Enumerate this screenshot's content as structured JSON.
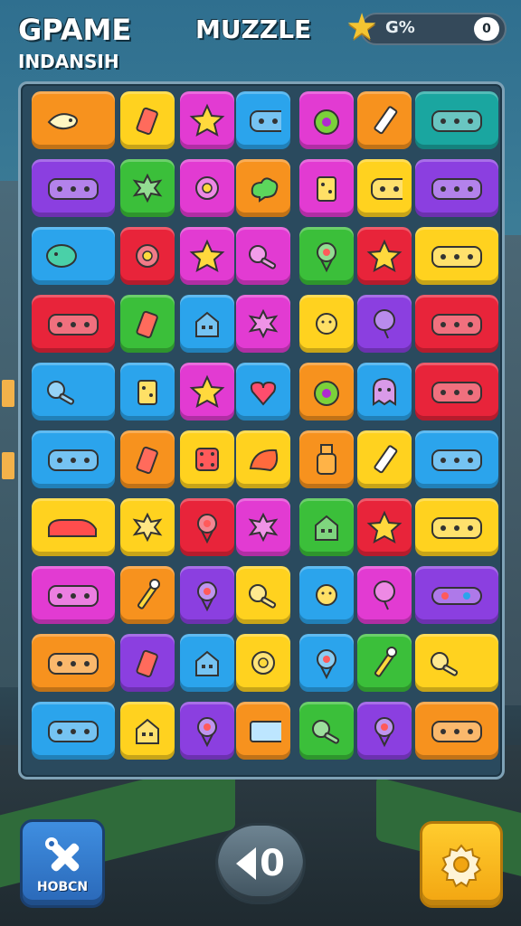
{
  "header": {
    "title_left": "GPAME",
    "subtitle_left": "INDANSIH",
    "title_center": "MUZZLE",
    "score_text": "G%",
    "score_toggle": "0"
  },
  "controls": {
    "tool_button_label": "HOBCN",
    "counter_value": "0"
  },
  "colors": {
    "orange": "#f7921e",
    "yellow": "#ffd21f",
    "magenta": "#e23bd2",
    "blue": "#2ba4ec",
    "purple": "#8b3fe0",
    "green": "#3bbf3a",
    "red": "#e8243a",
    "teal": "#1aa6a0"
  },
  "board": {
    "rows": [
      [
        {
          "color": "orange",
          "icon": "fish-icon"
        },
        {
          "color": "yellow",
          "icon": "cup-icon"
        },
        {
          "color": "magenta",
          "icon": "star-icon"
        },
        {
          "color": "blue",
          "icon": "bus-icon"
        },
        {
          "color": "magenta",
          "icon": "apple-icon"
        },
        {
          "color": "orange",
          "icon": "pencil-icon"
        },
        {
          "color": "teal",
          "icon": "bus-icon"
        }
      ],
      [
        {
          "color": "purple",
          "icon": "bus-icon"
        },
        {
          "color": "green",
          "icon": "splat-icon"
        },
        {
          "color": "magenta",
          "icon": "flower-icon"
        },
        {
          "color": "orange",
          "icon": "cloud-icon"
        },
        {
          "color": "magenta",
          "icon": "cheese-icon"
        },
        {
          "color": "yellow",
          "icon": "bus-icon"
        },
        {
          "color": "purple",
          "icon": "bus-icon"
        }
      ],
      [
        {
          "color": "blue",
          "icon": "blob-icon"
        },
        {
          "color": "red",
          "icon": "flower-icon"
        },
        {
          "color": "magenta",
          "icon": "star-icon"
        },
        {
          "color": "magenta",
          "icon": "key-icon"
        },
        {
          "color": "green",
          "icon": "pin-icon"
        },
        {
          "color": "red",
          "icon": "star-icon"
        },
        {
          "color": "yellow",
          "icon": "bus-icon"
        }
      ],
      [
        {
          "color": "red",
          "icon": "bus-icon"
        },
        {
          "color": "green",
          "icon": "cup-icon"
        },
        {
          "color": "blue",
          "icon": "house-icon"
        },
        {
          "color": "magenta",
          "icon": "splat-icon"
        },
        {
          "color": "yellow",
          "icon": "sun-icon"
        },
        {
          "color": "purple",
          "icon": "balloon-icon"
        },
        {
          "color": "red",
          "icon": "bus-icon"
        }
      ],
      [
        {
          "color": "blue",
          "icon": "key-icon"
        },
        {
          "color": "blue",
          "icon": "cheese-icon"
        },
        {
          "color": "magenta",
          "icon": "star-icon"
        },
        {
          "color": "blue",
          "icon": "heart-icon"
        },
        {
          "color": "orange",
          "icon": "apple-icon"
        },
        {
          "color": "blue",
          "icon": "ghost-icon"
        },
        {
          "color": "red",
          "icon": "bus-icon"
        }
      ],
      [
        {
          "color": "blue",
          "icon": "bus-icon"
        },
        {
          "color": "orange",
          "icon": "cup-icon"
        },
        {
          "color": "yellow",
          "icon": "dice-icon"
        },
        {
          "color": "yellow",
          "icon": "shell-icon"
        },
        {
          "color": "orange",
          "icon": "bottle-icon"
        },
        {
          "color": "yellow",
          "icon": "pencil-icon"
        },
        {
          "color": "blue",
          "icon": "bus-icon"
        }
      ],
      [
        {
          "color": "yellow",
          "icon": "car-icon"
        },
        {
          "color": "yellow",
          "icon": "splat-icon"
        },
        {
          "color": "red",
          "icon": "pin-icon"
        },
        {
          "color": "magenta",
          "icon": "splat-icon"
        },
        {
          "color": "green",
          "icon": "house-icon"
        },
        {
          "color": "red",
          "icon": "star-icon"
        },
        {
          "color": "yellow",
          "icon": "bus-icon"
        }
      ],
      [
        {
          "color": "magenta",
          "icon": "bus-icon"
        },
        {
          "color": "orange",
          "icon": "wand-icon"
        },
        {
          "color": "purple",
          "icon": "pin-icon"
        },
        {
          "color": "yellow",
          "icon": "key-icon"
        },
        {
          "color": "blue",
          "icon": "sun-icon"
        },
        {
          "color": "magenta",
          "icon": "balloon-icon"
        },
        {
          "color": "purple",
          "icon": "pill-icon"
        }
      ],
      [
        {
          "color": "orange",
          "icon": "bus-icon"
        },
        {
          "color": "purple",
          "icon": "cup-icon"
        },
        {
          "color": "blue",
          "icon": "house-icon"
        },
        {
          "color": "yellow",
          "icon": "flower-icon"
        },
        {
          "color": "blue",
          "icon": "pin-icon"
        },
        {
          "color": "green",
          "icon": "wand-icon"
        },
        {
          "color": "yellow",
          "icon": "key-icon"
        }
      ],
      [
        {
          "color": "blue",
          "icon": "bus-icon"
        },
        {
          "color": "yellow",
          "icon": "house-icon"
        },
        {
          "color": "purple",
          "icon": "pin-icon"
        },
        {
          "color": "orange",
          "icon": "flag-icon"
        },
        {
          "color": "green",
          "icon": "key-icon"
        },
        {
          "color": "purple",
          "icon": "pin-icon"
        },
        {
          "color": "orange",
          "icon": "bus-icon"
        }
      ]
    ]
  }
}
